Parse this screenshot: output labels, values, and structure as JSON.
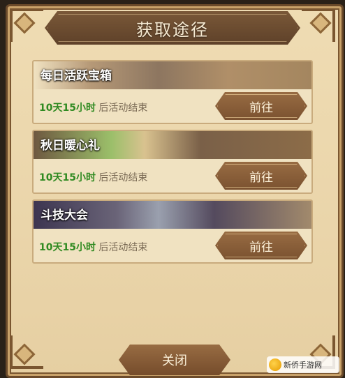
{
  "dialog": {
    "title": "获取途径",
    "close_label": "关闭"
  },
  "cards": [
    {
      "name": "每日活跃宝箱",
      "time_value": "10天15小时",
      "time_suffix": "后活动结束",
      "button_label": "前往"
    },
    {
      "name": "秋日暖心礼",
      "time_value": "10天15小时",
      "time_suffix": "后活动结束",
      "button_label": "前往"
    },
    {
      "name": "斗技大会",
      "time_value": "10天15小时",
      "time_suffix": "后活动结束",
      "button_label": "前往"
    }
  ],
  "watermark": {
    "text": "新侨手游网"
  },
  "colors": {
    "time_green": "#2f8a21",
    "button_brown": "#8a6039",
    "panel_parchment": "#ead5aa"
  }
}
